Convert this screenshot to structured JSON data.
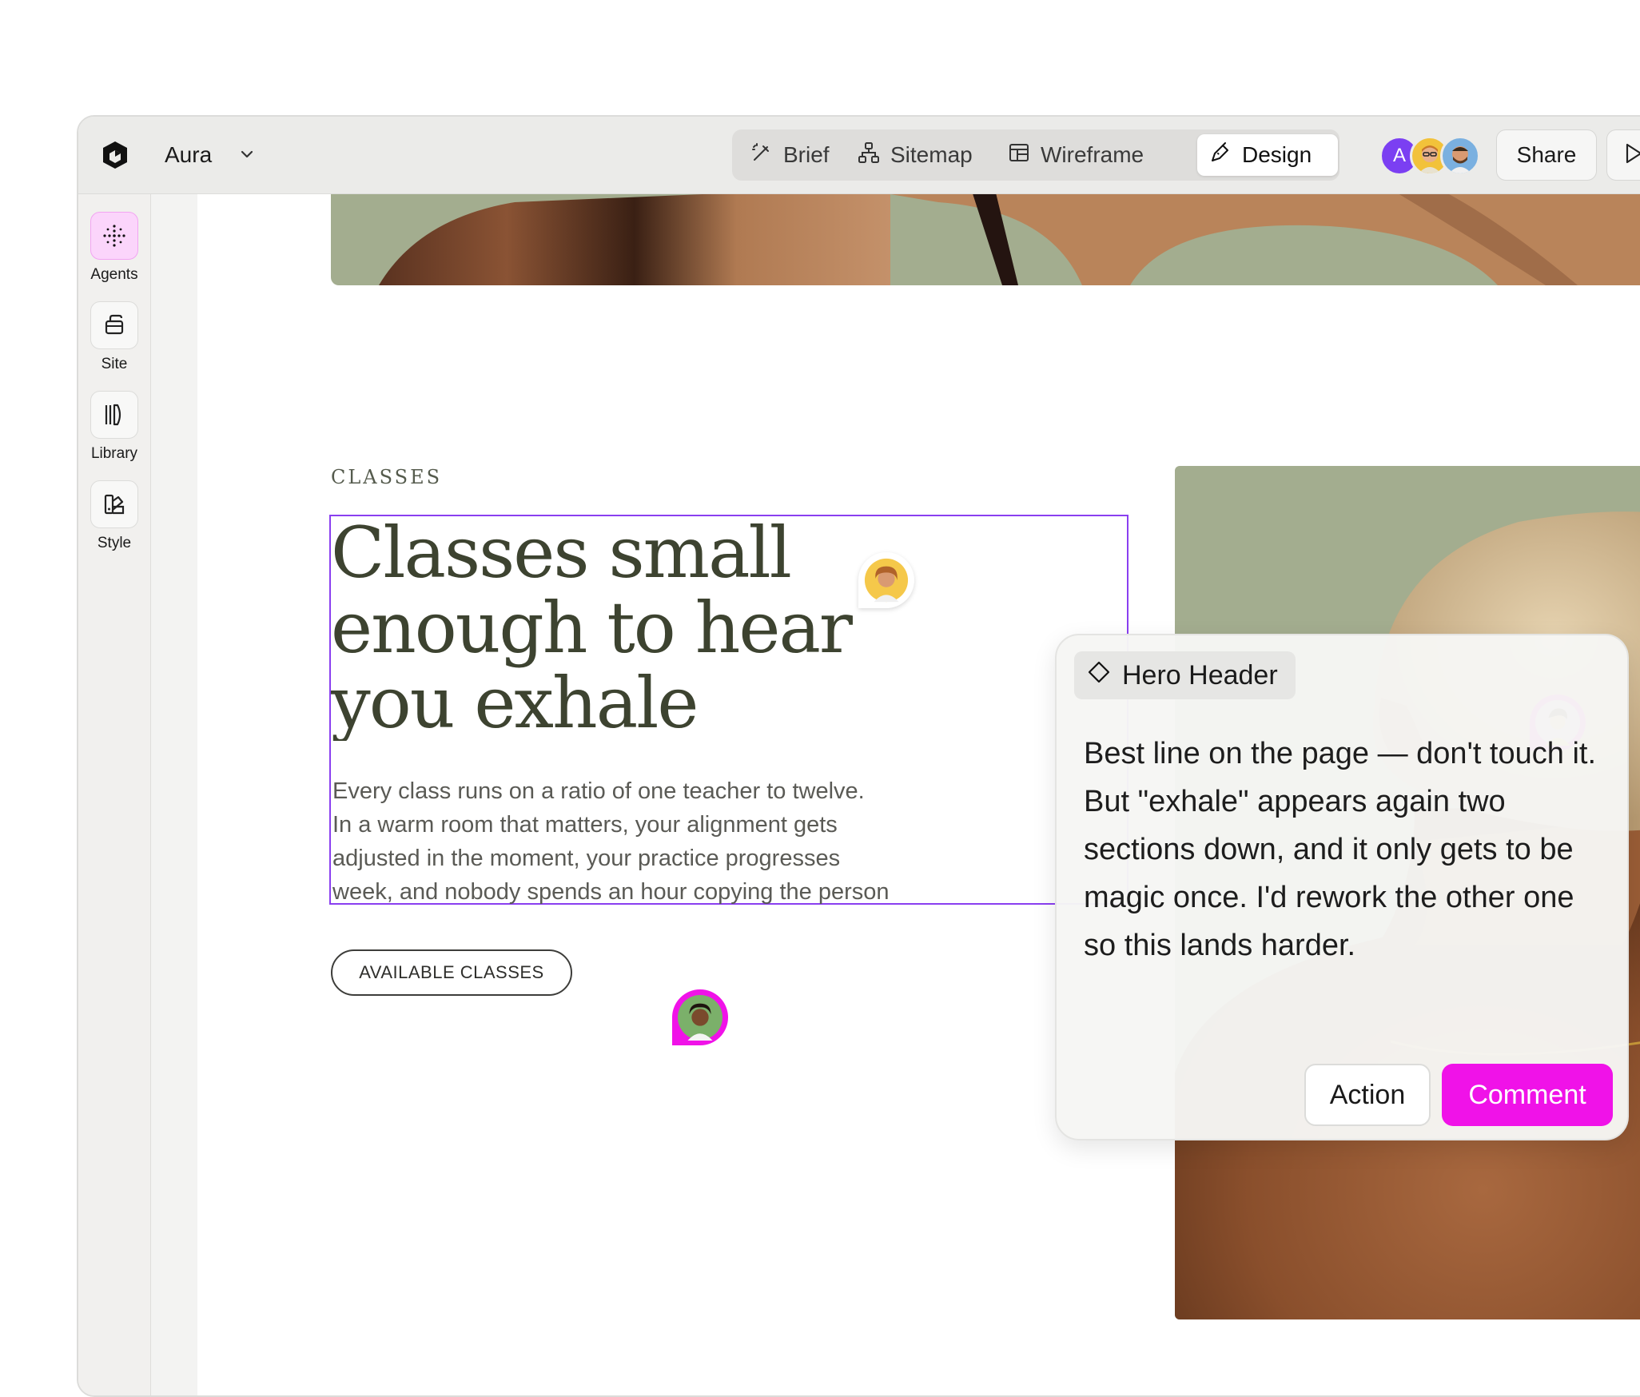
{
  "topbar": {
    "project_name": "Aura",
    "modes": [
      {
        "label": "Brief",
        "icon": "brief-icon"
      },
      {
        "label": "Sitemap",
        "icon": "sitemap-icon"
      },
      {
        "label": "Wireframe",
        "icon": "wireframe-icon"
      },
      {
        "label": "Design",
        "icon": "design-icon",
        "active": true
      }
    ],
    "collaborators": [
      "A",
      "avatar-man-glasses",
      "avatar-man-beard"
    ],
    "share_label": "Share"
  },
  "sidebar": {
    "items": [
      {
        "label": "Agents",
        "icon": "agents-icon",
        "active": true
      },
      {
        "label": "Site",
        "icon": "site-icon"
      },
      {
        "label": "Library",
        "icon": "library-icon"
      },
      {
        "label": "Style",
        "icon": "style-icon"
      }
    ]
  },
  "page": {
    "eyebrow": "CLASSES",
    "headline": [
      "Classes small",
      "enough to hear",
      "you exhale"
    ],
    "body": [
      "Every class runs on a ratio of one teacher to twelve.",
      "In a warm room that matters, your alignment gets",
      "adjusted in the moment, your practice progresses",
      "week, and nobody spends an hour copying the person"
    ],
    "cta_label": "AVAILABLE CLASSES"
  },
  "comment_panel": {
    "tag": "Hero Header",
    "text": "Best line on the page — don't touch it. But \"exhale\" appears again two sections down, and it only gets to be magic once. I'd rework the other one so this lands harder.",
    "action_label": "Action",
    "comment_label": "Comment"
  },
  "colors": {
    "accent": "#f012e8",
    "selection": "#8a3ff0",
    "headline": "#3d4330",
    "photo_bg": "#a3ad8f",
    "agents_active": "#fbd5fb"
  }
}
